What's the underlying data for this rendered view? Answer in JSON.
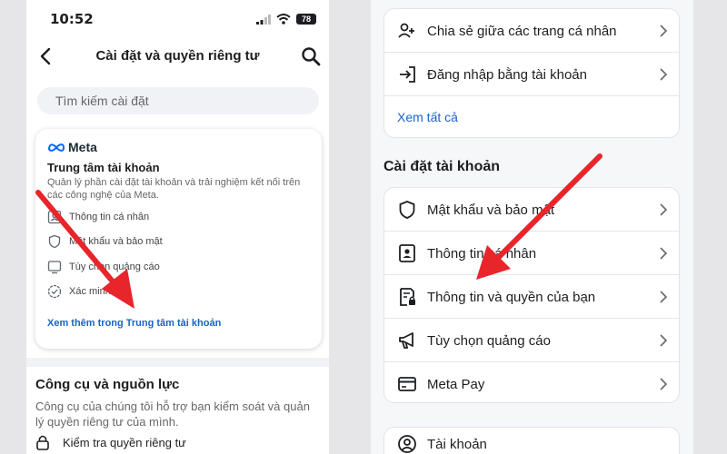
{
  "status": {
    "time": "10:52",
    "battery": "78"
  },
  "header": {
    "title": "Cài đặt và quyền riêng tư"
  },
  "search": {
    "placeholder": "Tìm kiếm cài đặt"
  },
  "meta_card": {
    "brand": "Meta",
    "title": "Trung tâm tài khoản",
    "description": "Quản lý phần cài đặt tài khoản và trải nghiệm kết nối trên các công nghệ của Meta.",
    "items": [
      {
        "label": "Thông tin cá nhân",
        "icon": "person-card-icon"
      },
      {
        "label": "Mật khẩu và bảo mật",
        "icon": "shield-icon"
      },
      {
        "label": "Tùy chọn quảng cáo",
        "icon": "monitor-icon"
      },
      {
        "label": "Xác minh",
        "icon": "verified-badge-icon"
      }
    ],
    "link": "Xem thêm trong Trung tâm tài khoản"
  },
  "tools": {
    "title": "Công cụ và nguồn lực",
    "description": "Công cụ của chúng tôi hỗ trợ bạn kiểm soát và quản lý quyền riêng tư của mình.",
    "first_item": "Kiểm tra quyền riêng tư"
  },
  "right": {
    "top_card": [
      {
        "label": "Chia sẻ giữa các trang cá nhân",
        "icon": "people-share-icon"
      },
      {
        "label": "Đăng nhập bằng tài khoản",
        "icon": "login-arrow-icon"
      }
    ],
    "see_all": "Xem tất cả",
    "section_title": "Cài đặt tài khoản",
    "account_items": [
      {
        "label": "Mật khẩu và bảo mật",
        "icon": "shield-icon"
      },
      {
        "label": "Thông tin cá nhân",
        "icon": "person-card-icon"
      },
      {
        "label": "Thông tin và quyền của bạn",
        "icon": "document-lock-icon"
      },
      {
        "label": "Tùy chọn quảng cáo",
        "icon": "megaphone-icon"
      },
      {
        "label": "Meta Pay",
        "icon": "card-icon"
      }
    ],
    "bottom_item": {
      "label": "Tài khoản",
      "icon": "account-circle-icon"
    }
  },
  "colors": {
    "arrow": "#e8252b",
    "link": "#1a63c8"
  }
}
